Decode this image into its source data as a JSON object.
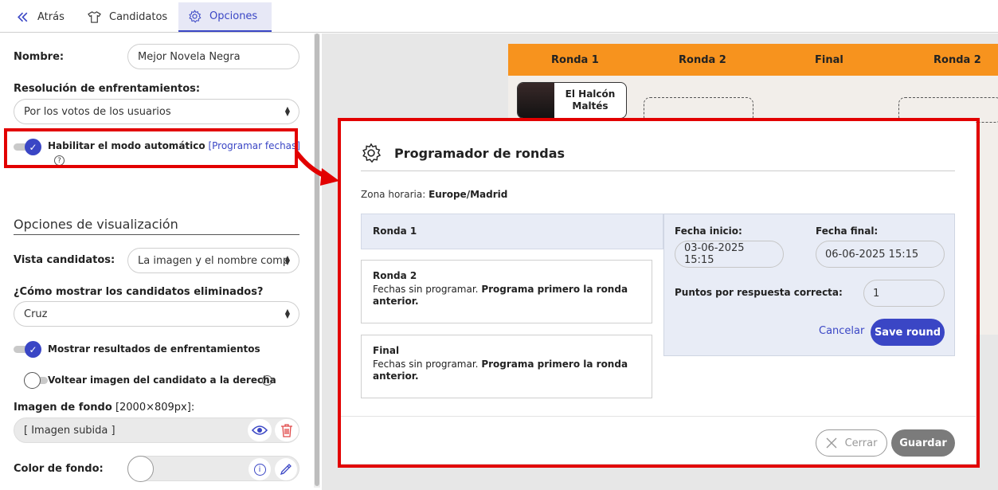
{
  "tabs": {
    "back": "Atrás",
    "candidates": "Candidatos",
    "options": "Opciones"
  },
  "settings": {
    "name_label": "Nombre:",
    "name_value": "Mejor Novela Negra",
    "resolution_label": "Resolución de enfrentamientos:",
    "resolution_value": "Por los votos de los usuarios",
    "auto_mode_label": "Habilitar el modo automático",
    "schedule_link": "Programar fechas",
    "auto_mode_on": true,
    "display_section": "Opciones de visualización",
    "view_label": "Vista candidatos:",
    "view_value": "La imagen y el nombre comp",
    "eliminated_label": "¿Cómo mostrar los candidatos eliminados?",
    "eliminated_value": "Cruz",
    "show_results_label": "Mostrar resultados de enfrentamientos",
    "show_results_on": true,
    "flip_label": "Voltear imagen del candidato a la derecha",
    "flip_on": false,
    "bg_image_label": "Imagen de fondo",
    "bg_image_size": "[2000×809px]:",
    "bg_image_value": "[ Imagen subida ]",
    "bg_color_label": "Color de fondo:"
  },
  "bracket": {
    "headers": [
      "Ronda 1",
      "Ronda 2",
      "Final",
      "Ronda 2"
    ],
    "candidate_name": "El Halcón Maltés",
    "header_color": "#f7931e"
  },
  "modal": {
    "title": "Programador de rondas",
    "timezone_label": "Zona horaria:",
    "timezone_value": "Europe/Madrid",
    "rounds": [
      {
        "title": "Ronda 1",
        "text": "",
        "bold": ""
      },
      {
        "title": "Ronda 2",
        "text": "Fechas sin programar.",
        "bold": "Programa primero la ronda anterior."
      },
      {
        "title": "Final",
        "text": "Fechas sin programar.",
        "bold": "Programa primero la ronda anterior."
      }
    ],
    "start_label": "Fecha inicio:",
    "start_value": "03-06-2025 15:15",
    "end_label": "Fecha final:",
    "end_value": "06-06-2025 15:15",
    "points_label": "Puntos por respuesta correcta:",
    "points_value": "1",
    "cancel_label": "Cancelar",
    "save_round_label": "Save round",
    "close_label": "Cerrar",
    "guardar_label": "Guardar"
  },
  "colors": {
    "accent": "#3a46c5",
    "highlight": "#e20000"
  }
}
